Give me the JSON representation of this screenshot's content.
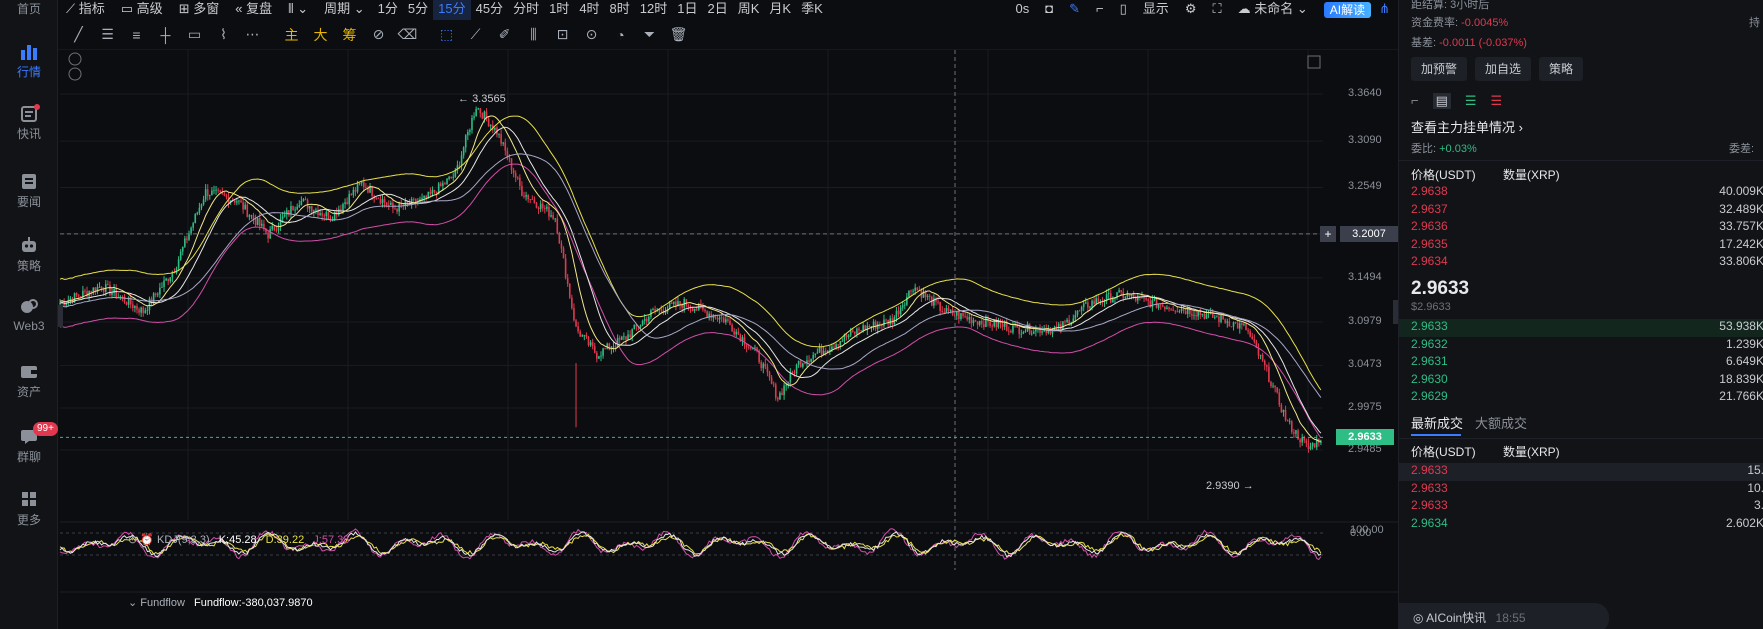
{
  "nav": [
    {
      "label": "首页",
      "icon": "home-icon"
    },
    {
      "label": "行情",
      "icon": "market-icon",
      "active": true
    },
    {
      "label": "快讯",
      "icon": "flash-news-icon",
      "dot": true
    },
    {
      "label": "要闻",
      "icon": "news-icon"
    },
    {
      "label": "策略",
      "icon": "robot-icon"
    },
    {
      "label": "Web3",
      "icon": "web3-icon"
    },
    {
      "label": "资产",
      "icon": "wallet-icon"
    },
    {
      "label": "群聊",
      "icon": "chat-icon",
      "badge": "99+"
    },
    {
      "label": "更多",
      "icon": "more-grid-icon"
    }
  ],
  "toolbar": {
    "indicators": "指标",
    "advanced": "高级",
    "multi_window": "多窗",
    "replay": "复盘",
    "period": "周期",
    "intervals": [
      "1分",
      "5分",
      "15分",
      "45分",
      "分时",
      "1时",
      "4时",
      "8时",
      "12时",
      "1日",
      "2日",
      "周K",
      "月K",
      "季K"
    ],
    "selected_interval": "15分",
    "countdown": "0s",
    "display": "显示",
    "layout_name": "未命名",
    "ai_label": "AI解读"
  },
  "drawtools": [
    "主",
    "大",
    "筹"
  ],
  "chart": {
    "price_ticks": [
      "3.3640",
      "3.3090",
      "3.2549",
      "3.2007",
      "3.1494",
      "3.0979",
      "3.0473",
      "2.9975",
      "2.9485"
    ],
    "crosshair_price": "3.2007",
    "current_price_tag": "2.9633",
    "high_label": "3.3565",
    "low_label": "2.9390",
    "kdj": {
      "name": "KDJ(9,3,3)",
      "k": "K:45.28",
      "d": "D:39.22",
      "j": "J:57.38"
    },
    "kdj_ticks": [
      "100.00",
      "0.00"
    ],
    "fundflow": {
      "name": "Fundflow",
      "value": "Fundflow:-380,037.9870"
    },
    "colors": {
      "up": "#2ebd85",
      "down": "#e0394f",
      "accent": "#3b7cff",
      "ma_yellow": "#e8e04a",
      "ma_pink": "#d04fa8"
    }
  },
  "right": {
    "countdown_label": "距结算:",
    "countdown_value": "3小时后",
    "funding_label": "资金费率:",
    "funding_value": "-0.0045%",
    "hold_label": "持",
    "basis_label": "基差:",
    "basis_value": "-0.0011 (-0.037%)",
    "buttons": [
      "加预警",
      "加自选",
      "策略"
    ],
    "main_orders": "查看主力挂单情况",
    "ratio_label": "委比:",
    "ratio_value": "+0.03%",
    "diff_label": "委差:",
    "col_price": "价格(USDT)",
    "col_qty": "数量(XRP)",
    "asks": [
      {
        "p": "2.9638",
        "q": "40.009K"
      },
      {
        "p": "2.9637",
        "q": "32.489K"
      },
      {
        "p": "2.9636",
        "q": "33.757K"
      },
      {
        "p": "2.9635",
        "q": "17.242K"
      },
      {
        "p": "2.9634",
        "q": "33.806K"
      }
    ],
    "last_price": "2.9633",
    "last_price_usd": "$2.9633",
    "bids": [
      {
        "p": "2.9633",
        "q": "53.938K"
      },
      {
        "p": "2.9632",
        "q": "1.239K"
      },
      {
        "p": "2.9631",
        "q": "6.649K"
      },
      {
        "p": "2.9630",
        "q": "18.839K"
      },
      {
        "p": "2.9629",
        "q": "21.766K"
      }
    ],
    "tab_latest": "最新成交",
    "tab_large": "大额成交",
    "trades": [
      {
        "p": "2.9633",
        "q": "15.",
        "side": "sell"
      },
      {
        "p": "2.9633",
        "q": "10.",
        "side": "sell"
      },
      {
        "p": "2.9633",
        "q": "3.",
        "side": "sell"
      },
      {
        "p": "2.9634",
        "q": "2.602K",
        "side": "buy"
      }
    ],
    "flash_label": "AICoin快讯",
    "flash_time": "18:55"
  }
}
